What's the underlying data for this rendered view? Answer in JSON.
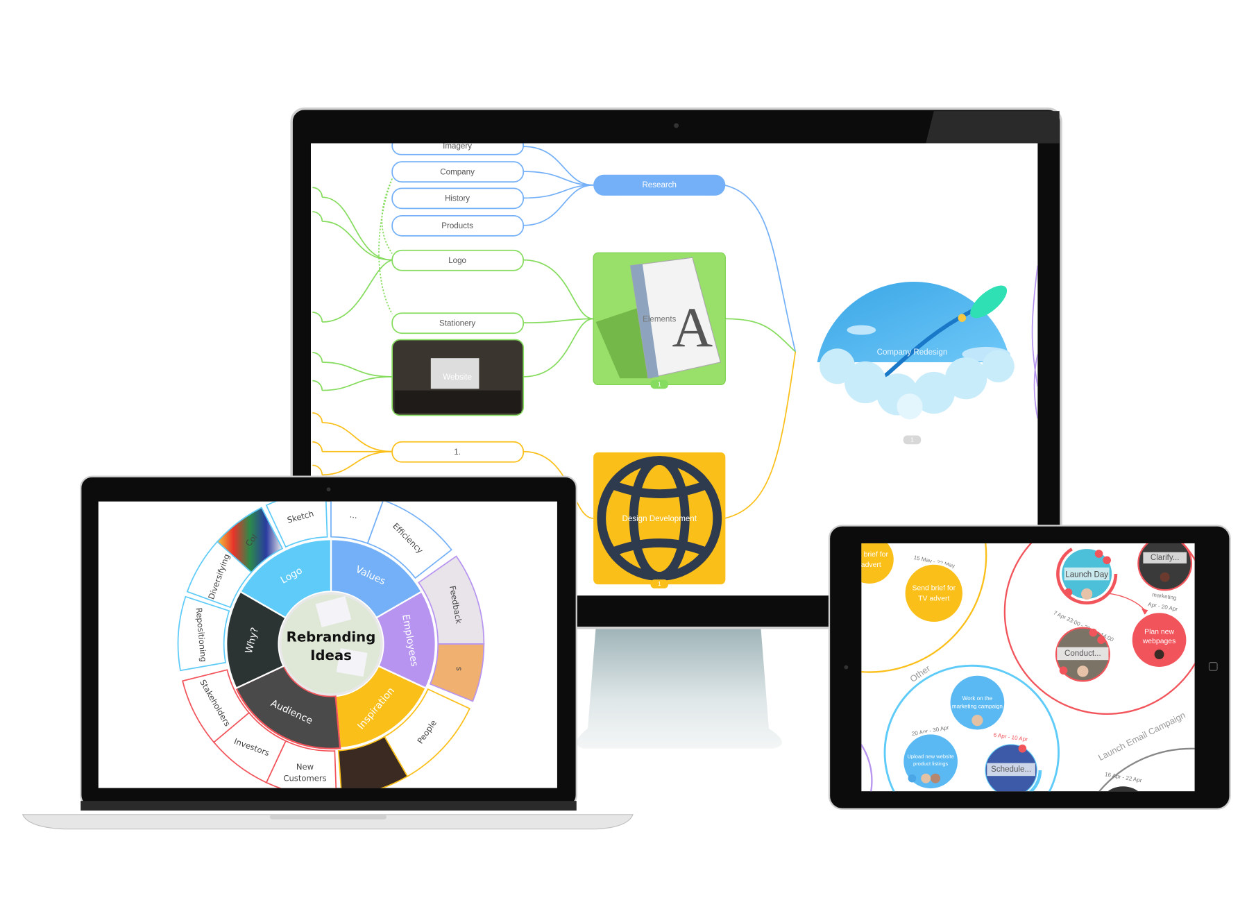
{
  "monitor": {
    "mindmap": {
      "nodes": {
        "imagery": "Imagery",
        "company": "Company",
        "history": "History",
        "products": "Products",
        "logo": "Logo",
        "stationery": "Stationery",
        "website": "Website",
        "one": "1.",
        "research": "Research",
        "elements": "Elements",
        "design_development": "Design Development",
        "company_redesign": "Company Redesign"
      },
      "attachment_counts": {
        "elements": "1",
        "design_development": "1",
        "company_redesign": "1"
      }
    }
  },
  "laptop": {
    "wheel": {
      "center_lines": [
        "Rebranding",
        "Ideas"
      ],
      "inner": [
        "Values",
        "Employees",
        "Inspiration",
        "Audience",
        "Why?",
        "Logo"
      ],
      "outer": [
        "...",
        "Efficiency",
        "Feedback",
        "s",
        "People",
        "",
        "New Customers",
        "Investors",
        "Stakeholders",
        "Repositioning",
        "Diversifying",
        "Col",
        "Sketch"
      ]
    }
  },
  "tablet": {
    "rings": {
      "other": "Other",
      "launch_email_campaign": "Launch Email Campaign"
    },
    "bubbles": {
      "brief_advert": {
        "lines": [
          "brief for",
          "advert"
        ]
      },
      "send_brief": {
        "lines": [
          "Send brief for",
          "TV advert"
        ],
        "date": "15 May - 22 May"
      },
      "launch_day": {
        "label": "Launch Day"
      },
      "clarify": {
        "label": "Clarify..."
      },
      "plan_webpages": {
        "lines": [
          "Plan new",
          "webpages"
        ],
        "tag": "marketing",
        "date": "Apr - 20 Apr"
      },
      "conduct": {
        "label": "Conduct...",
        "date": "7 Apr 23:00 - 20 Apr 14:00"
      },
      "work_marketing": {
        "lines": [
          "Work on the",
          "marketing campaign"
        ]
      },
      "upload_listings": {
        "lines": [
          "Upload new website",
          "product listings"
        ],
        "date": "20 Apr - 30 Apr"
      },
      "schedule": {
        "label": "Schedule...",
        "date": "6 Apr - 10 Apr"
      },
      "email_campaign": {
        "date": "16 Apr - 22 Apr"
      }
    }
  },
  "colors": {
    "blue": "#74b0f7",
    "light_blue": "#5ecbf8",
    "green": "#86dc5e",
    "yellow": "#fbbf1a",
    "purple": "#b794f0",
    "red": "#f2545b",
    "dark_navy": "#2e3a4e"
  }
}
